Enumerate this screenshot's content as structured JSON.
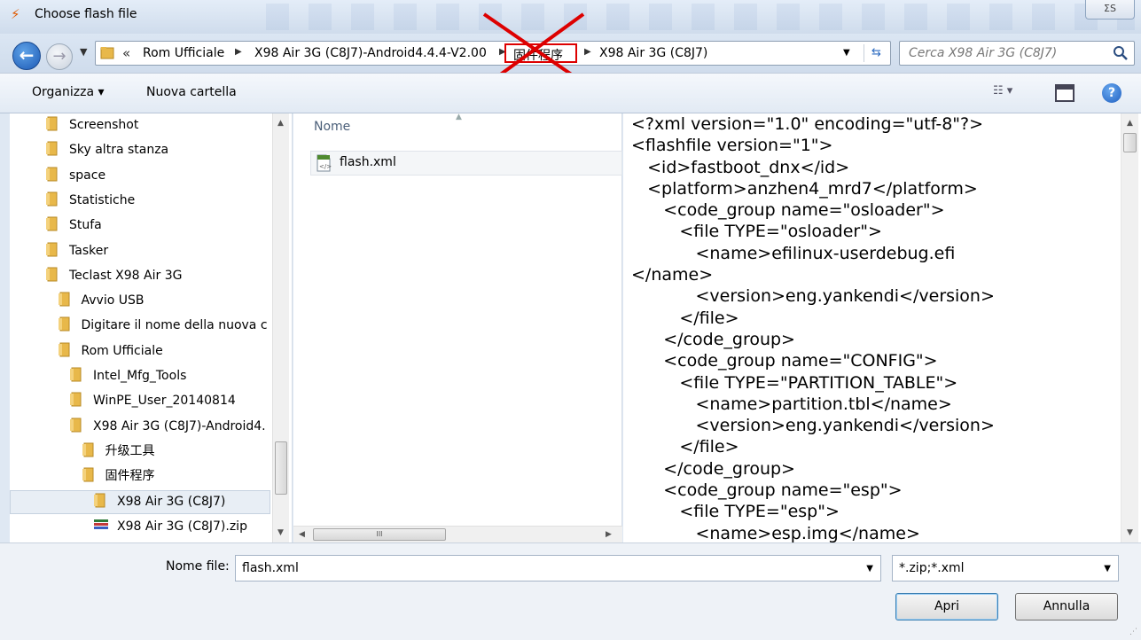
{
  "window": {
    "title": "Choose flash file",
    "close_label": "ΣS"
  },
  "address": {
    "overflow": "«",
    "crumbs": [
      "Rom Ufficiale",
      "X98 Air 3G (C8J7)-Android4.4.4-V2.00",
      "固件程序",
      "X98 Air 3G (C8J7)"
    ],
    "search_placeholder": "Cerca X98 Air 3G (C8J7)"
  },
  "toolbar": {
    "organize": "Organizza ▾",
    "new_folder": "Nuova cartella",
    "view": "☷ ▾"
  },
  "nav": {
    "items": [
      {
        "label": "Screenshot",
        "indent": 0
      },
      {
        "label": "Sky altra stanza",
        "indent": 0
      },
      {
        "label": "space",
        "indent": 0
      },
      {
        "label": "Statistiche",
        "indent": 0
      },
      {
        "label": "Stufa",
        "indent": 0
      },
      {
        "label": "Tasker",
        "indent": 0
      },
      {
        "label": "Teclast X98 Air 3G",
        "indent": 0
      },
      {
        "label": "Avvio USB",
        "indent": 1
      },
      {
        "label": "Digitare il nome della nuova c",
        "indent": 1
      },
      {
        "label": "Rom Ufficiale",
        "indent": 1
      },
      {
        "label": "Intel_Mfg_Tools",
        "indent": 2
      },
      {
        "label": "WinPE_User_20140814",
        "indent": 2
      },
      {
        "label": "X98 Air 3G (C8J7)-Android4.",
        "indent": 2
      },
      {
        "label": "升级工具",
        "indent": 3
      },
      {
        "label": "固件程序",
        "indent": 3
      },
      {
        "label": "X98 Air 3G (C8J7)",
        "indent": 4
      },
      {
        "label": "X98 Air 3G (C8J7).zip",
        "indent": 4
      }
    ]
  },
  "files": {
    "column_name": "Nome",
    "items": [
      "flash.xml"
    ],
    "hscroll_grip": "III"
  },
  "preview": {
    "lines": [
      "<?xml version=\"1.0\" encoding=\"utf-8\"?>",
      "<flashfile version=\"1\">",
      "   <id>fastboot_dnx</id>",
      "   <platform>anzhen4_mrd7</platform>",
      "      <code_group name=\"osloader\">",
      "         <file TYPE=\"osloader\">",
      "            <name>efilinux-userdebug.efi",
      "</name>",
      "            <version>eng.yankendi</version>",
      "         </file>",
      "      </code_group>",
      "      <code_group name=\"CONFIG\">",
      "         <file TYPE=\"PARTITION_TABLE\">",
      "            <name>partition.tbl</name>",
      "            <version>eng.yankendi</version>",
      "         </file>",
      "      </code_group>",
      "      <code_group name=\"esp\">",
      "         <file TYPE=\"esp\">",
      "            <name>esp.img</name>"
    ]
  },
  "footer": {
    "filename_label": "Nome file:",
    "filename_value": "flash.xml",
    "filter_value": "*.zip;*.xml",
    "open_label": "Apri",
    "cancel_label": "Annulla"
  },
  "colors": {
    "annotation_red": "#dd0000",
    "folder": "#e8b84a"
  }
}
